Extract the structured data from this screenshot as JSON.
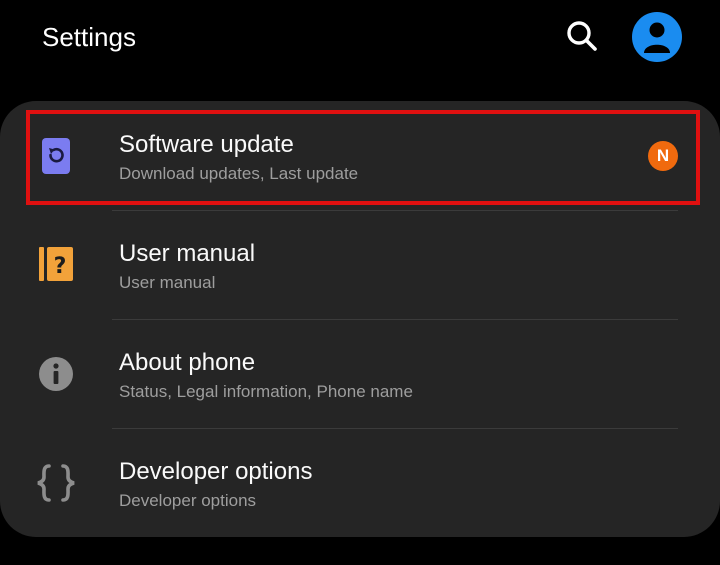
{
  "header": {
    "title": "Settings"
  },
  "items": [
    {
      "label": "Software update",
      "sub": "Download updates, Last update",
      "badge": "N"
    },
    {
      "label": "User manual",
      "sub": "User manual"
    },
    {
      "label": "About phone",
      "sub": "Status, Legal information, Phone name"
    },
    {
      "label": "Developer options",
      "sub": "Developer options"
    }
  ],
  "colors": {
    "background": "#000000",
    "card": "#252525",
    "avatar": "#1a8cf0",
    "software_update_icon": "#7b7cf0",
    "user_manual_icon": "#f2a23a",
    "badge": "#f06a0e",
    "highlight": "#e01010"
  },
  "icons": {
    "search": "search-icon",
    "avatar": "account-icon",
    "software_update": "software-update-icon",
    "user_manual": "user-manual-icon",
    "about_phone": "info-icon",
    "developer_options": "braces-icon"
  }
}
